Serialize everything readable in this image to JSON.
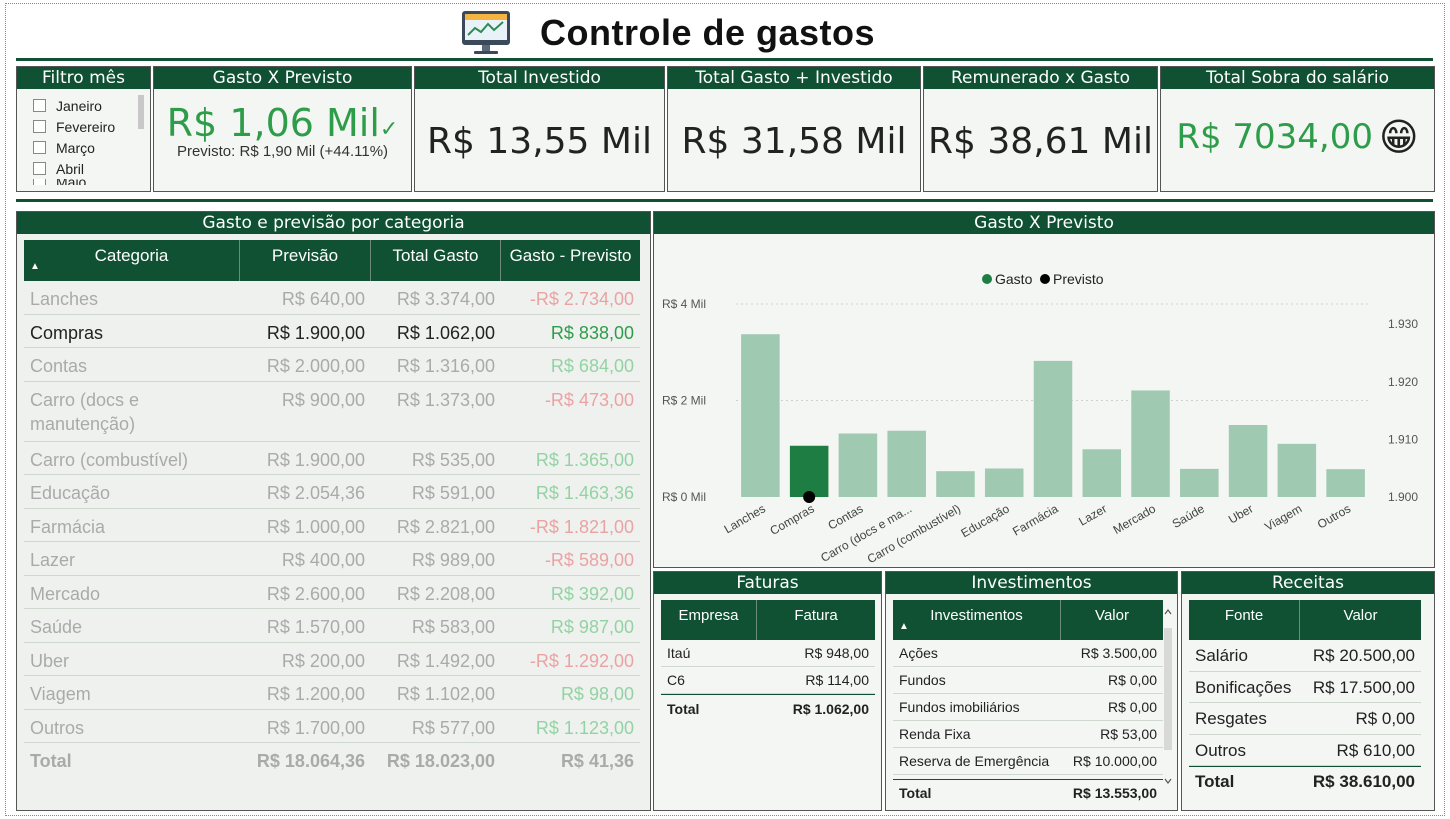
{
  "header": {
    "title": "Controle de gastos",
    "icon": "monitor-chart-icon"
  },
  "filter": {
    "title": "Filtro mês",
    "months": [
      "Janeiro",
      "Fevereiro",
      "Março",
      "Abril",
      "Maio"
    ]
  },
  "kpis": {
    "gasto_previsto": {
      "title": "Gasto X Previsto",
      "value": "R$ 1,06 Mil",
      "check": "✓",
      "sub": "Previsto: R$ 1,90 Mil (+44.11%)"
    },
    "total_investido": {
      "title": "Total Investido",
      "value": "R$ 13,55 Mil"
    },
    "total_gasto_investido": {
      "title": "Total Gasto + Investido",
      "value": "R$ 31,58 Mil"
    },
    "remunerado_gasto": {
      "title": "Remunerado x Gasto",
      "value": "R$ 38,61 Mil"
    },
    "total_sobra": {
      "title": "Total Sobra do salário",
      "value": "R$ 7034,00",
      "emoji": "😁"
    }
  },
  "category_table": {
    "title": "Gasto e previsão por categoria",
    "sort_icon": "▲",
    "columns": [
      "Categoria",
      "Previsão",
      "Total Gasto",
      "Gasto - Previsto"
    ],
    "rows": [
      {
        "cat": "Lanches",
        "prev": "R$ 640,00",
        "gasto": "R$ 3.374,00",
        "diff": "-R$ 2.734,00",
        "neg": true,
        "selected": false
      },
      {
        "cat": "Compras",
        "prev": "R$ 1.900,00",
        "gasto": "R$ 1.062,00",
        "diff": "R$ 838,00",
        "neg": false,
        "selected": true
      },
      {
        "cat": "Contas",
        "prev": "R$ 2.000,00",
        "gasto": "R$ 1.316,00",
        "diff": "R$ 684,00",
        "neg": false,
        "selected": false
      },
      {
        "cat": "Carro (docs e",
        "cat2": "manutenção)",
        "prev": "R$ 900,00",
        "gasto": "R$ 1.373,00",
        "diff": "-R$ 473,00",
        "neg": true,
        "selected": false
      },
      {
        "cat": "Carro (combustível)",
        "prev": "R$ 1.900,00",
        "gasto": "R$ 535,00",
        "diff": "R$ 1.365,00",
        "neg": false,
        "selected": false
      },
      {
        "cat": "Educação",
        "prev": "R$ 2.054,36",
        "gasto": "R$ 591,00",
        "diff": "R$ 1.463,36",
        "neg": false,
        "selected": false
      },
      {
        "cat": "Farmácia",
        "prev": "R$ 1.000,00",
        "gasto": "R$ 2.821,00",
        "diff": "-R$ 1.821,00",
        "neg": true,
        "selected": false
      },
      {
        "cat": "Lazer",
        "prev": "R$ 400,00",
        "gasto": "R$ 989,00",
        "diff": "-R$ 589,00",
        "neg": true,
        "selected": false
      },
      {
        "cat": "Mercado",
        "prev": "R$ 2.600,00",
        "gasto": "R$ 2.208,00",
        "diff": "R$ 392,00",
        "neg": false,
        "selected": false
      },
      {
        "cat": "Saúde",
        "prev": "R$ 1.570,00",
        "gasto": "R$ 583,00",
        "diff": "R$ 987,00",
        "neg": false,
        "selected": false
      },
      {
        "cat": "Uber",
        "prev": "R$ 200,00",
        "gasto": "R$ 1.492,00",
        "diff": "-R$ 1.292,00",
        "neg": true,
        "selected": false
      },
      {
        "cat": "Viagem",
        "prev": "R$ 1.200,00",
        "gasto": "R$ 1.102,00",
        "diff": "R$ 98,00",
        "neg": false,
        "selected": false
      },
      {
        "cat": "Outros",
        "prev": "R$ 1.700,00",
        "gasto": "R$ 577,00",
        "diff": "R$ 1.123,00",
        "neg": false,
        "selected": false
      }
    ],
    "total": {
      "label": "Total",
      "prev": "R$ 18.064,36",
      "gasto": "R$ 18.023,00",
      "diff": "R$ 41,36"
    }
  },
  "chart_panel": {
    "title": "Gasto X Previsto"
  },
  "chart_data": {
    "type": "bar",
    "title": "Gasto X Previsto",
    "categories": [
      "Lanches",
      "Compras",
      "Contas",
      "Carro (docs e ma...",
      "Carro (combustível)",
      "Educação",
      "Farmácia",
      "Lazer",
      "Mercado",
      "Saúde",
      "Uber",
      "Viagem",
      "Outros"
    ],
    "series": [
      {
        "name": "Gasto",
        "kind": "bar",
        "axis": "left",
        "values": [
          3374,
          1062,
          1316,
          1373,
          535,
          591,
          2821,
          989,
          2208,
          583,
          1492,
          1102,
          577
        ]
      },
      {
        "name": "Previsto",
        "kind": "point",
        "axis": "right",
        "values": [
          null,
          1900,
          null,
          null,
          null,
          null,
          null,
          null,
          null,
          null,
          null,
          null,
          null
        ]
      }
    ],
    "ylim": [
      0,
      4000
    ],
    "y_ticks": [
      0,
      2000,
      4000
    ],
    "y_tick_labels": [
      "R$ 0 Mil",
      "R$ 2 Mil",
      "R$ 4 Mil"
    ],
    "y2lim": [
      1900,
      1933.5
    ],
    "y2_ticks": [
      1900,
      1910,
      1920,
      1930
    ],
    "y2_tick_labels": [
      "1.900",
      "1.910",
      "1.920",
      "1.930"
    ],
    "selected_category": "Compras",
    "legend": "top-center",
    "grid": true,
    "colors": {
      "bar": "#9fc9b0",
      "selected_bar": "#1e7d42",
      "point": "#000000"
    }
  },
  "faturas": {
    "title": "Faturas",
    "columns": [
      "Empresa",
      "Fatura"
    ],
    "rows": [
      {
        "a": "Itaú",
        "b": "R$ 948,00"
      },
      {
        "a": "C6",
        "b": "R$ 114,00"
      }
    ],
    "total": {
      "a": "Total",
      "b": "R$ 1.062,00"
    }
  },
  "investimentos": {
    "title": "Investimentos",
    "sort_icon": "▲",
    "columns": [
      "Investimentos",
      "Valor"
    ],
    "rows": [
      {
        "a": "Ações",
        "b": "R$ 3.500,00"
      },
      {
        "a": "Fundos",
        "b": "R$ 0,00"
      },
      {
        "a": "Fundos imobiliários",
        "b": "R$ 0,00"
      },
      {
        "a": "Renda Fixa",
        "b": "R$ 53,00"
      },
      {
        "a": "Reserva de Emergência",
        "b": "R$ 10.000,00"
      }
    ],
    "total": {
      "a": "Total",
      "b": "R$ 13.553,00"
    }
  },
  "receitas": {
    "title": "Receitas",
    "columns": [
      "Fonte",
      "Valor"
    ],
    "rows": [
      {
        "a": "Salário",
        "b": "R$ 20.500,00"
      },
      {
        "a": "Bonificações",
        "b": "R$ 17.500,00"
      },
      {
        "a": "Resgates",
        "b": "R$ 0,00"
      },
      {
        "a": "Outros",
        "b": "R$ 610,00"
      }
    ],
    "total": {
      "a": "Total",
      "b": "R$ 38.610,00"
    }
  },
  "colors": {
    "brand": "#0f5132",
    "positive": "#2e9d4a",
    "bar": "#9fc9b0",
    "selected_bar": "#1e7d42"
  }
}
